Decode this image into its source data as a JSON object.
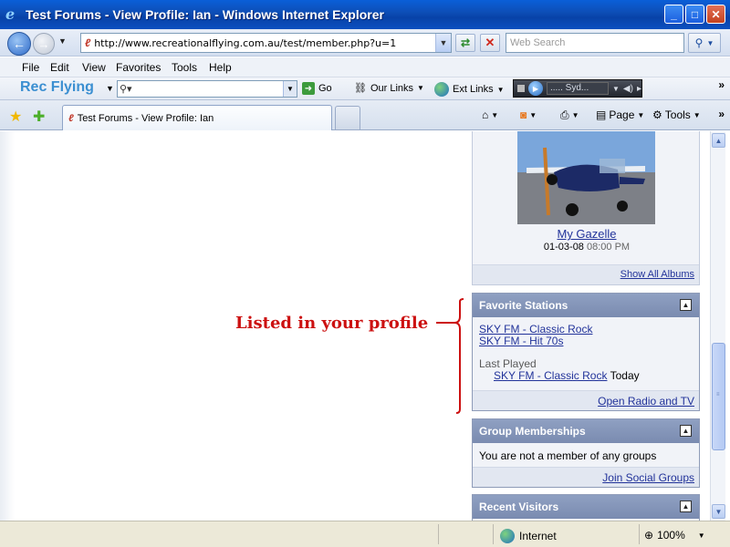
{
  "window": {
    "title": "Test Forums - View Profile: Ian - Windows Internet Explorer"
  },
  "address": {
    "url": "http://www.recreationalflying.com.au/test/member.php?u=1",
    "search_placeholder": "Web Search"
  },
  "menu": {
    "items": [
      {
        "label": "File"
      },
      {
        "label": "Edit"
      },
      {
        "label": "View"
      },
      {
        "label": "Favorites"
      },
      {
        "label": "Tools"
      },
      {
        "label": "Help"
      }
    ]
  },
  "custom_toolbar": {
    "brand": "Rec Flying",
    "go_label": "Go",
    "our_links": "Our Links",
    "ext_links": "Ext Links",
    "player_station": "..... Syd..."
  },
  "tab": {
    "title": "Test Forums - View Profile: Ian"
  },
  "commands": {
    "page": "Page",
    "tools": "Tools"
  },
  "album": {
    "title": "My Gazelle",
    "date": "01-03-08",
    "time": "08:00 PM",
    "show_all": "Show All Albums"
  },
  "favorite_stations": {
    "heading": "Favorite Stations",
    "stations": [
      "SKY FM - Classic Rock",
      "SKY FM - Hit 70s"
    ],
    "last_played_label": "Last Played",
    "last_played_station": "SKY FM - Classic Rock",
    "last_played_when": "Today",
    "footer_link": "Open Radio and TV"
  },
  "group_memberships": {
    "heading": "Group Memberships",
    "text": "You are not a member of any groups",
    "footer_link": "Join Social Groups"
  },
  "recent_visitors": {
    "heading": "Recent Visitors"
  },
  "annotation": {
    "text": "Listed in your profile"
  },
  "status": {
    "zone": "Internet",
    "zoom": "100%"
  },
  "colors": {
    "annotation": "#cc1111",
    "block_header": "#7f90b5",
    "link": "#22339a"
  }
}
